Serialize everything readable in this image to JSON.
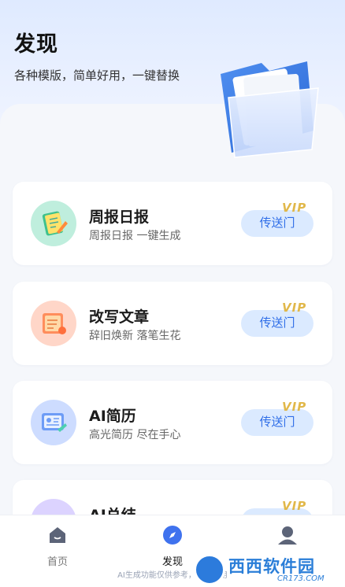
{
  "header": {
    "title": "发现",
    "subtitle": "各种模版，简单好用，一键替换"
  },
  "cards": [
    {
      "title": "周报日报",
      "subtitle": "周报日报 一键生成",
      "button": "传送门",
      "badge": "VIP",
      "icon": "notebook-pencil-icon"
    },
    {
      "title": "改写文章",
      "subtitle": "辞旧焕新 落笔生花",
      "button": "传送门",
      "badge": "VIP",
      "icon": "scroll-pen-icon"
    },
    {
      "title": "AI简历",
      "subtitle": "高光简历 尽在手心",
      "button": "传送门",
      "badge": "VIP",
      "icon": "resume-card-icon"
    },
    {
      "title": "AI总结",
      "subtitle": "",
      "button": "传送门",
      "badge": "VIP",
      "icon": "summary-icon"
    }
  ],
  "tabbar": {
    "tabs": [
      {
        "label": "首页",
        "icon": "home-icon",
        "active": false
      },
      {
        "label": "发现",
        "icon": "compass-icon",
        "active": true
      },
      {
        "label": "",
        "icon": "profile-icon",
        "active": false
      }
    ]
  },
  "footer": {
    "disclaimer": "AI生成功能仅供参考，禁止利用"
  },
  "watermark": {
    "name": "西西软件园",
    "url": "CR173.COM"
  },
  "colors": {
    "accent": "#2f6ee8",
    "button_bg": "#dbeaff",
    "vip": "#e1b84a"
  }
}
